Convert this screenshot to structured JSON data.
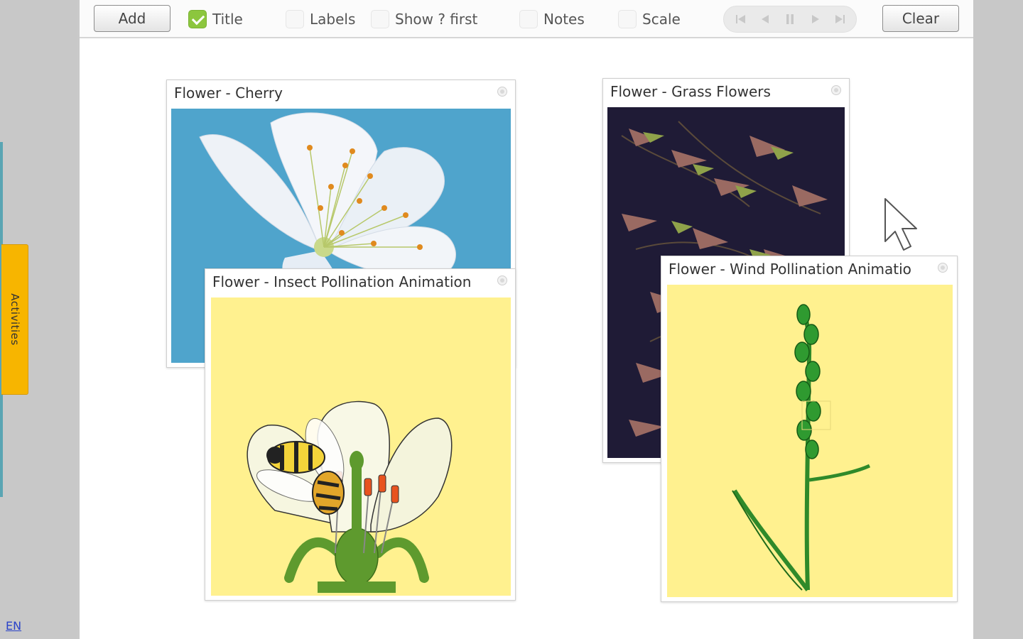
{
  "toolbar": {
    "add_label": "Add",
    "clear_label": "Clear",
    "options": [
      {
        "label": "Title",
        "checked": true
      },
      {
        "label": "Labels",
        "checked": false
      },
      {
        "label": "Show ? first",
        "checked": false
      },
      {
        "label": "Notes",
        "checked": false
      },
      {
        "label": "Scale",
        "checked": false
      }
    ],
    "player": {
      "icons": [
        "skip-start-icon",
        "step-back-icon",
        "pause-icon",
        "step-forward-icon",
        "skip-end-icon"
      ]
    }
  },
  "sidebar": {
    "activities_label": "Activities",
    "language_label": "EN"
  },
  "windows": [
    {
      "title": "Flower - Cherry",
      "content": "cherry-blossom-photo"
    },
    {
      "title": "Flower - Grass Flowers",
      "content": "grass-flowers-photo"
    },
    {
      "title": "Flower - Insect Pollination Animation",
      "content": "bee-on-flower-animation"
    },
    {
      "title": "Flower - Wind Pollination Animatio",
      "content": "grass-stem-animation"
    }
  ],
  "colors": {
    "activities_tab": "#f7b500",
    "checkbox_checked": "#8cc63e",
    "cherry_background": "#4fa4cc",
    "animation_background": "#fff18f",
    "grass_background": "#1f1b36",
    "language_link": "#2a43c9"
  }
}
